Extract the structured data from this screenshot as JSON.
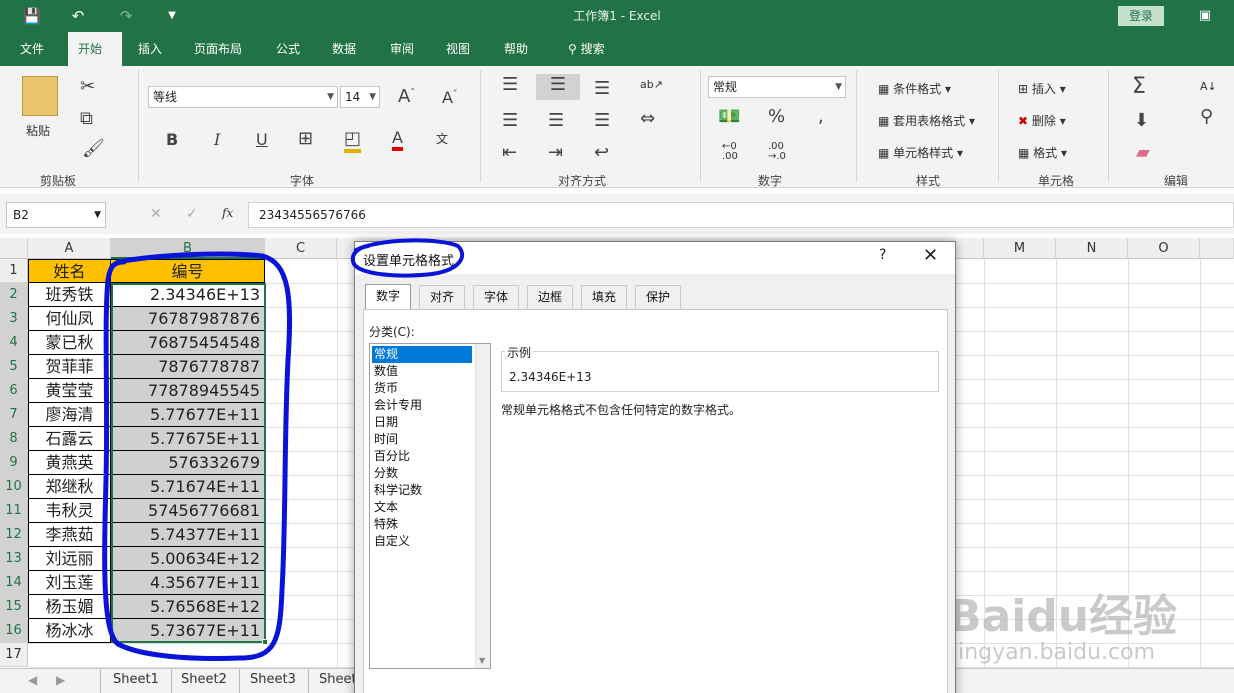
{
  "window": {
    "title": "工作簿1  -  Excel",
    "login": "登录",
    "quick_access": [
      "save-icon",
      "undo-icon",
      "redo-icon",
      "customize-icon"
    ]
  },
  "ribbon": {
    "tabs": [
      "文件",
      "开始",
      "插入",
      "页面布局",
      "公式",
      "数据",
      "审阅",
      "视图",
      "帮助",
      "搜索"
    ],
    "active_tab": "开始",
    "groups": [
      "剪贴板",
      "字体",
      "对齐方式",
      "数字",
      "样式",
      "单元格",
      "编辑"
    ],
    "clipboard": {
      "paste": "粘贴"
    },
    "font": {
      "name": "等线",
      "size": "14"
    },
    "number": {
      "format": "常规"
    },
    "styles": {
      "conditional": "条件格式",
      "table": "套用表格格式",
      "cell": "单元格样式"
    },
    "cells": {
      "insert": "插入",
      "delete": "删除",
      "format": "格式"
    }
  },
  "formula_bar": {
    "name_box": "B2",
    "fx": "fx",
    "value": "23434556576766"
  },
  "sheet": {
    "columns": [
      "A",
      "B",
      "C",
      "M",
      "N",
      "O"
    ],
    "rows": [
      "1",
      "2",
      "3",
      "4",
      "5",
      "6",
      "7",
      "8",
      "9",
      "10",
      "11",
      "12",
      "13",
      "14",
      "15",
      "16",
      "17"
    ],
    "headers": {
      "name": "姓名",
      "code": "编号"
    },
    "data": [
      {
        "name": "班秀铁",
        "code": "2.34346E+13"
      },
      {
        "name": "何仙凤",
        "code": "76787987876"
      },
      {
        "name": "蒙已秋",
        "code": "76875454548"
      },
      {
        "name": "贺菲菲",
        "code": "7876778787"
      },
      {
        "name": "黄莹莹",
        "code": "77878945545"
      },
      {
        "name": "廖海清",
        "code": "5.77677E+11"
      },
      {
        "name": "石露云",
        "code": "5.77675E+11"
      },
      {
        "name": "黄燕英",
        "code": "576332679"
      },
      {
        "name": "郑继秋",
        "code": "5.71674E+11"
      },
      {
        "name": "韦秋灵",
        "code": "57456776681"
      },
      {
        "name": "李燕茹",
        "code": "5.74377E+11"
      },
      {
        "name": "刘远丽",
        "code": "5.00634E+12"
      },
      {
        "name": "刘玉莲",
        "code": "4.35677E+11"
      },
      {
        "name": "杨玉媚",
        "code": "5.76568E+12"
      },
      {
        "name": "杨冰冰",
        "code": "5.73677E+11"
      }
    ],
    "tabs": [
      "Sheet1",
      "Sheet2",
      "Sheet3",
      "Sheet"
    ]
  },
  "dialog": {
    "title": "设置单元格格式",
    "help": "?",
    "tabs": [
      "数字",
      "对齐",
      "字体",
      "边框",
      "填充",
      "保护"
    ],
    "category_label": "分类(C):",
    "categories": [
      "常规",
      "数值",
      "货币",
      "会计专用",
      "日期",
      "时间",
      "百分比",
      "分数",
      "科学记数",
      "文本",
      "特殊",
      "自定义"
    ],
    "selected_category": "常规",
    "sample_label": "示例",
    "sample_value": "2.34346E+13",
    "description": "常规单元格格式不包含任何特定的数字格式。"
  },
  "watermark": {
    "brand": "Baidu经验",
    "url": "jingyan.baidu.com"
  },
  "annotation_color": "#0a14d8"
}
